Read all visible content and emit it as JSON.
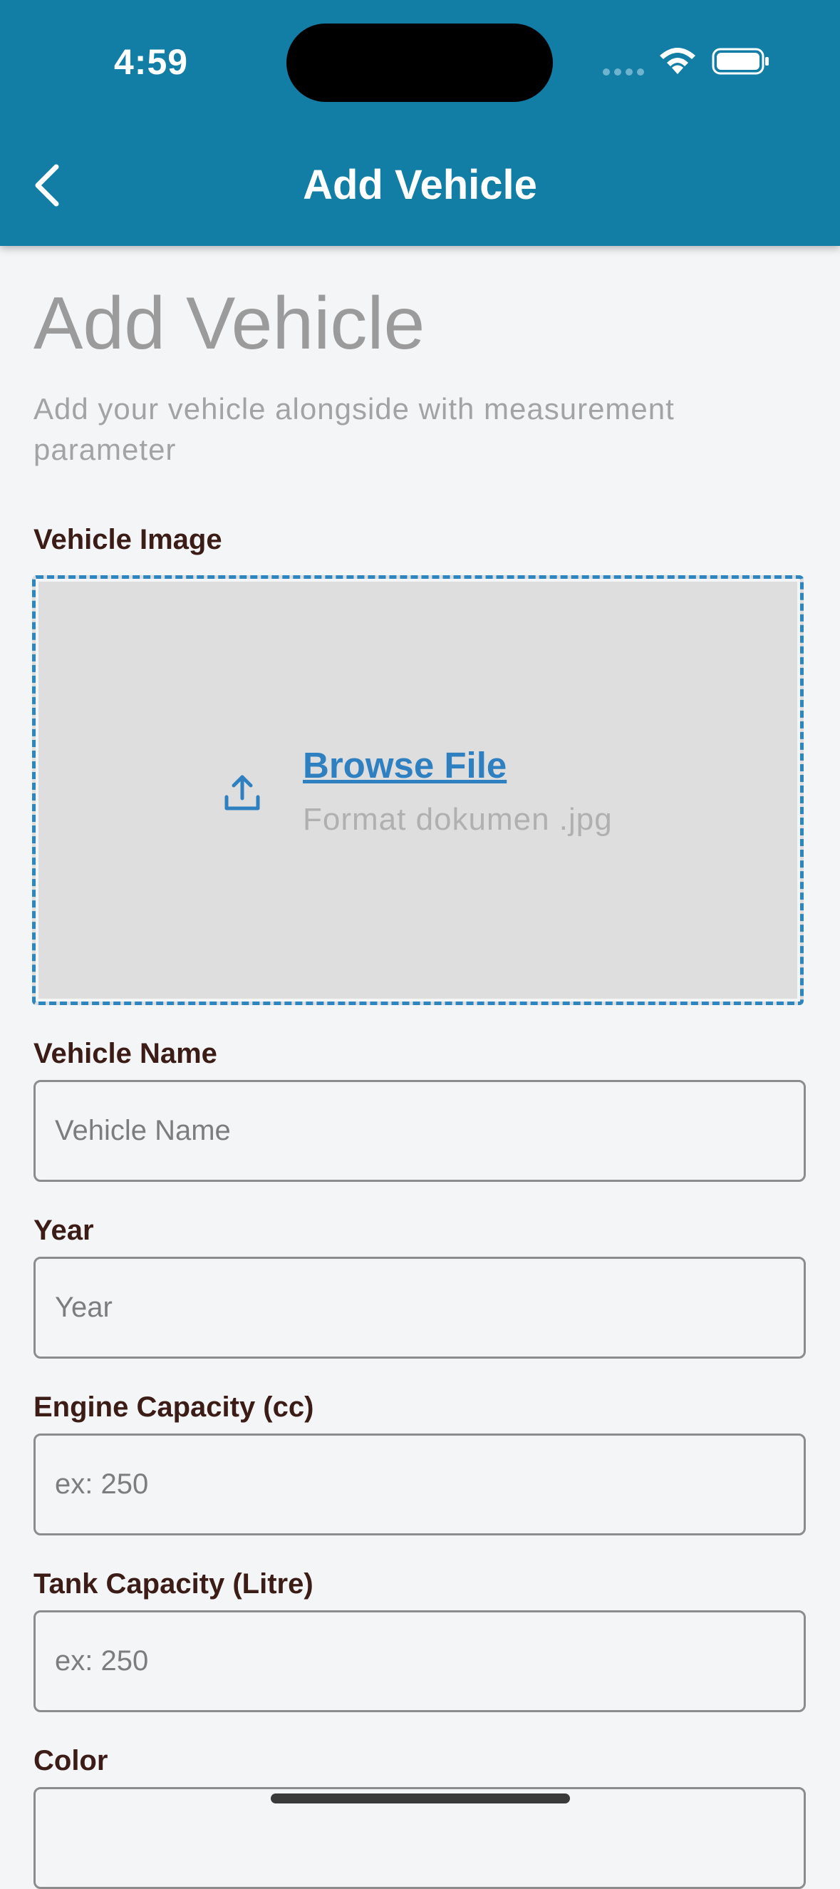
{
  "status_bar": {
    "time": "4:59"
  },
  "header": {
    "title": "Add Vehicle",
    "back_icon": "chevron-left-icon",
    "background_color": "#127ea6"
  },
  "page": {
    "title": "Add Vehicle",
    "subtitle": "Add your vehicle alongside with measurement parameter"
  },
  "vehicle_image": {
    "label": "Vehicle Image",
    "browse_label": "Browse File",
    "format_text": "Format dokumen .jpg",
    "icon": "upload-icon",
    "accent_color": "#2f80c0"
  },
  "fields": {
    "vehicle_name": {
      "label": "Vehicle Name",
      "placeholder": "Vehicle Name",
      "value": ""
    },
    "year": {
      "label": "Year",
      "placeholder": "Year",
      "value": ""
    },
    "engine_capacity": {
      "label": "Engine Capacity (cc)",
      "placeholder": "ex: 250",
      "value": ""
    },
    "tank_capacity": {
      "label": "Tank Capacity (Litre)",
      "placeholder": "ex: 250",
      "value": ""
    },
    "color": {
      "label": "Color",
      "placeholder": "",
      "value": ""
    }
  }
}
